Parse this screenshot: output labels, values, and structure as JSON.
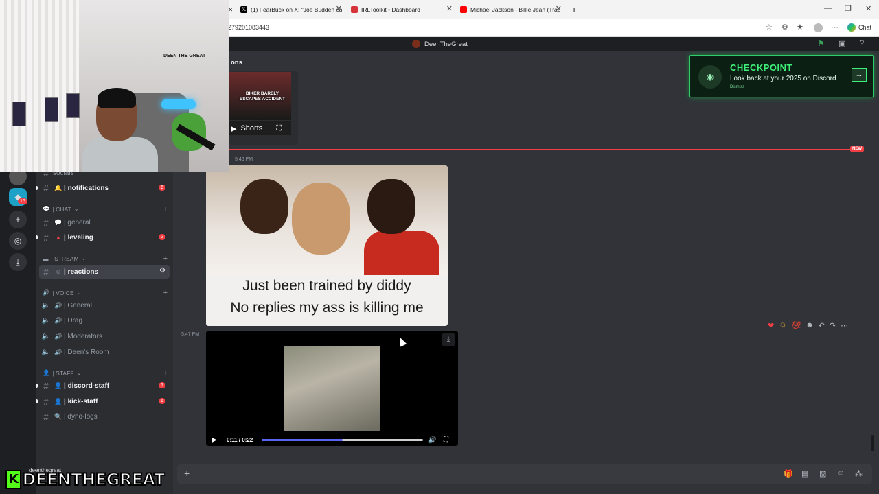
{
  "browser": {
    "tabs": [
      {
        "title": "(1) FearBuck on X: \"Joe Budden ca",
        "favicon": "x"
      },
      {
        "title": "IRLToolkit • Dashboard",
        "favicon": "irl"
      },
      {
        "title": "Michael Jackson - Billie Jean (Trap",
        "favicon": "youtube"
      }
    ],
    "address": "279201083443",
    "copilot_label": "Chat"
  },
  "discord": {
    "window_title": "DeenTheGreat",
    "channel_header": "ons",
    "server_badge": "16",
    "categories": {
      "chat": "| CHAT",
      "stream": "| STREAM",
      "voice": "| VOICE",
      "staff": "| STAFF"
    },
    "channels": {
      "socials": "socials",
      "notifications": "| notifications",
      "notifications_count": "6",
      "general": "| general",
      "leveling": "| leveling",
      "leveling_count": "2",
      "reactions": "| reactions",
      "voice_general": "| General",
      "voice_drag": "| Drag",
      "voice_moderators": "| Moderators",
      "voice_deens_room": "| Deen's Room",
      "discord_staff": "| discord-staff",
      "discord_staff_count": "1",
      "kick_staff": "| kick-staff",
      "kick_staff_count": "6",
      "dyno_logs": "| dyno-logs"
    },
    "messages": {
      "embed_thumb_text": "BIKER BARELY ESCAPES ACCIDENT",
      "embed_shorts_label": "Shorts",
      "new_label": "NEW",
      "time1": "5:46 PM",
      "meme_caption_line1": "Just been trained by diddy",
      "meme_caption_line2": "No replies my ass is killing me",
      "time2": "5:47 PM",
      "video_time": "0:11 / 0:22",
      "video_progress": 0.5
    },
    "checkpoint": {
      "title": "CHECKPOINT",
      "subtitle": "Look back at your 2025 on Discord",
      "dismiss": "Dismiss"
    },
    "user_panel": "deenthegreat"
  },
  "overlay": {
    "webcam_sign": "DEEN THE GREAT",
    "wordmark_k": "K",
    "wordmark_text": "DEENTHEGREAT"
  },
  "colors": {
    "accent_red": "#f23f43",
    "kick_green": "#53fc18",
    "checkpoint_green": "#3ef07a"
  }
}
